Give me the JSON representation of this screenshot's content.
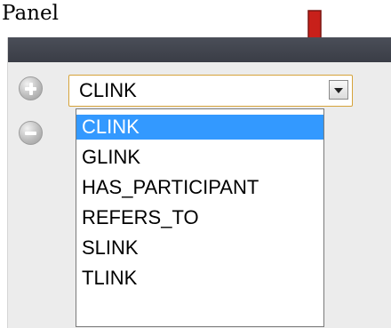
{
  "caption": {
    "text": "Panel"
  },
  "indicator": {
    "color": "#c8201a",
    "icon": "down-arrow-icon"
  },
  "panel": {
    "add_icon": "plus-circle-icon",
    "remove_icon": "minus-circle-icon"
  },
  "dropdown": {
    "selected_value": "CLINK",
    "accent_color": "#d6a33a",
    "options": [
      {
        "label": "CLINK",
        "highlighted": true
      },
      {
        "label": "GLINK",
        "highlighted": false
      },
      {
        "label": "HAS_PARTICIPANT",
        "highlighted": false
      },
      {
        "label": "REFERS_TO",
        "highlighted": false
      },
      {
        "label": "SLINK",
        "highlighted": false
      },
      {
        "label": "TLINK",
        "highlighted": false
      }
    ],
    "highlight_color": "#3399ff"
  }
}
